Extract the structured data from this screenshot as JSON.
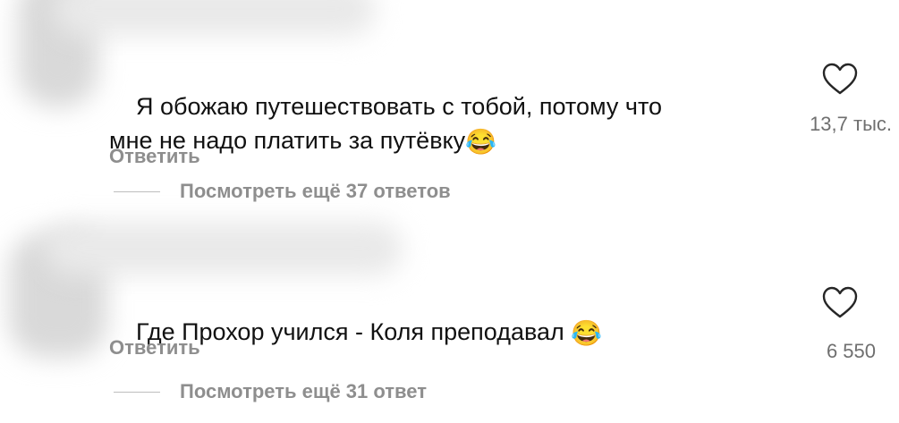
{
  "comments": [
    {
      "text": "Я обожаю путешествовать с тобой, потому что\nмне не надо платить за путёвку",
      "emoji": "😂",
      "reply_label": "Ответить",
      "view_replies_label": "Посмотреть ещё 37 ответов",
      "like_count": "13,7 тыс."
    },
    {
      "text": "Где Прохор учился - Коля преподавал ",
      "emoji": "😂",
      "reply_label": "Ответить",
      "view_replies_label": "Посмотреть ещё 31 ответ",
      "like_count": "6 550"
    }
  ],
  "icons": {
    "like": "heart-outline-icon"
  },
  "colors": {
    "text": "#111111",
    "secondary": "#8e8e8e",
    "like_count": "#6f6f6f",
    "background": "#ffffff"
  }
}
